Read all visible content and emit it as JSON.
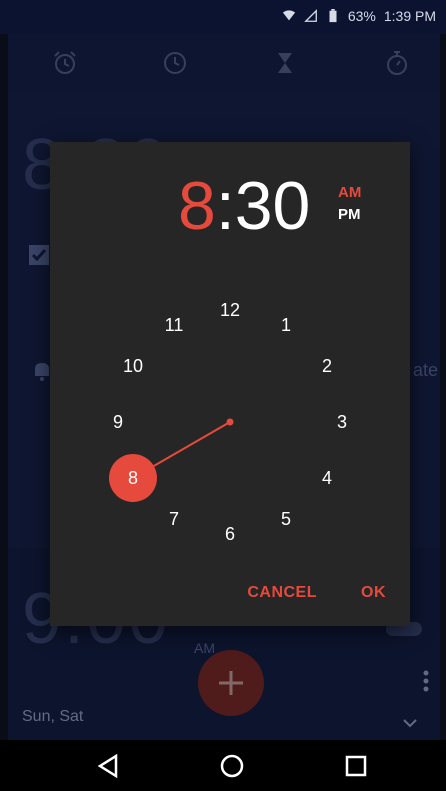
{
  "status_bar": {
    "battery": "63%",
    "time": "1:39 PM"
  },
  "tabs": [
    "alarm-icon",
    "clock-icon",
    "timer-icon",
    "stopwatch-icon"
  ],
  "background": {
    "alarm1_time": "8:30",
    "alarm2_time": "9:00",
    "alarm2_ampm": "AM",
    "days": "Sun, Sat",
    "partial_text": "ate"
  },
  "dialog": {
    "hour": "8",
    "separator": ":",
    "minute": "30",
    "am": "AM",
    "pm": "PM",
    "selected_period": "AM",
    "selected_hour": "8",
    "clock_numbers": [
      "12",
      "1",
      "2",
      "3",
      "4",
      "5",
      "6",
      "7",
      "8",
      "9",
      "10",
      "11"
    ],
    "cancel_label": "CANCEL",
    "ok_label": "OK"
  },
  "colors": {
    "accent": "#e64a3d",
    "dialog_bg": "#262626"
  }
}
